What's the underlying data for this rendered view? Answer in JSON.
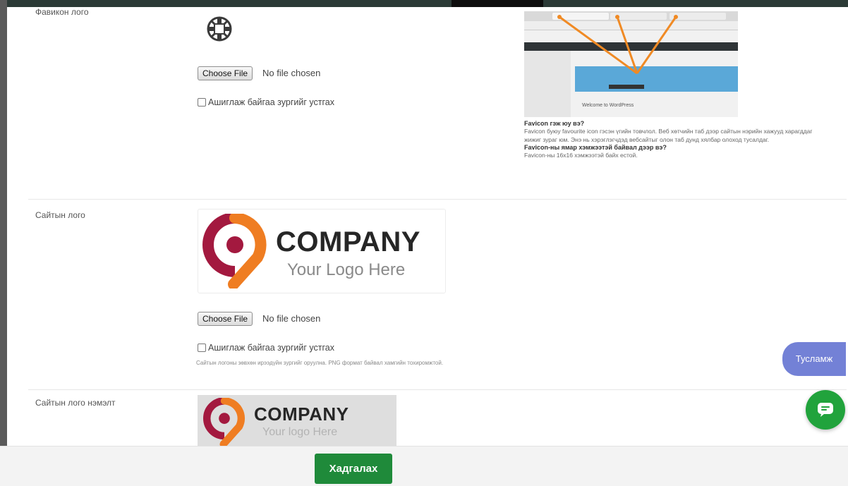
{
  "favicon": {
    "label": "Фавикон лого",
    "choose_file_label": "Choose File",
    "no_file_label": "No file chosen",
    "checkbox_label": "Ашиглаж байгаа зургийг устгах",
    "preview_caption": "Welcome to WordPress",
    "help_title_1": "Favicon гэж юу вэ?",
    "help_body_1": "Favicon буюу favourite icon гэсэн үгийн товчлол. Веб хөтчийн таб дээр сайтын нэрийн хажууд харагддаг жижиг зураг юм. Энэ нь хэрэглэгчдэд вебсайтыг олон таб дунд хялбар олоход тусалдаг.",
    "help_title_2": "Favicon-ны ямар хэмжээтэй байвал дээр вэ?",
    "help_body_2": "Favicon-ны 16х16 хэмжээтэй байх естой."
  },
  "site_logo": {
    "label": "Сайтын лого",
    "company_text": "COMPANY",
    "tagline_text": "Your Logo Here",
    "choose_file_label": "Choose File",
    "no_file_label": "No file chosen",
    "checkbox_label": "Ашиглаж байгаа зургийг устгах",
    "hint": "Сайтын логоны зөвхөн ирээдүйн зургийг оруулна. PNG формат байвал хамгийн тохиромжтой."
  },
  "site_logo_extra": {
    "label": "Сайтын лого нэмэлт",
    "company_text": "COMPANY",
    "tagline_text": "Your logo Here"
  },
  "footer": {
    "save_label": "Хадгалах"
  },
  "floating": {
    "help_label": "Тусламж"
  },
  "colors": {
    "accent_green": "#1f8a3a",
    "help_purple": "#7381d6",
    "logo_crimson": "#a3193f",
    "logo_orange": "#ef7d22"
  }
}
